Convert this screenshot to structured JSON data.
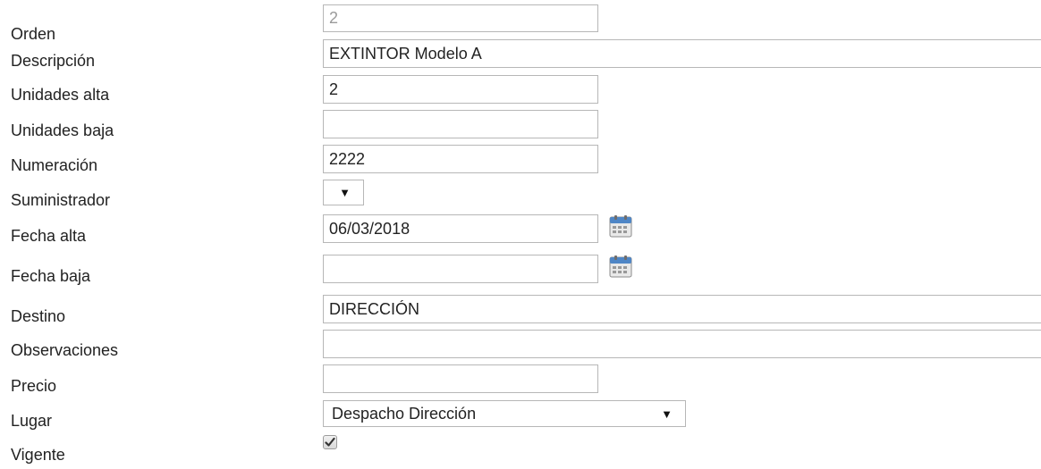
{
  "form": {
    "orden": {
      "label": "Orden",
      "value": "2"
    },
    "descripcion": {
      "label": "Descripción",
      "value": "EXTINTOR Modelo A"
    },
    "unidades_alta": {
      "label": "Unidades alta",
      "value": "2"
    },
    "unidades_baja": {
      "label": "Unidades baja",
      "value": ""
    },
    "numeracion": {
      "label": "Numeración",
      "value": "2222"
    },
    "suministrador": {
      "label": "Suministrador",
      "value": "",
      "arrow": "▼"
    },
    "fecha_alta": {
      "label": "Fecha alta",
      "value": "06/03/2018",
      "icon": "calendar-icon"
    },
    "fecha_baja": {
      "label": "Fecha baja",
      "value": "",
      "icon": "calendar-icon"
    },
    "destino": {
      "label": "Destino",
      "value": "DIRECCIÓN"
    },
    "observaciones": {
      "label": "Observaciones",
      "value": ""
    },
    "precio": {
      "label": "Precio",
      "value": ""
    },
    "lugar": {
      "label": "Lugar",
      "value": "Despacho Dirección",
      "arrow": "▼"
    },
    "vigente": {
      "label": "Vigente",
      "checked": true
    }
  },
  "colors": {
    "border": "#b7b7b7",
    "text": "#222222",
    "readonly_text": "#9a9a9a",
    "calendar_blue": "#4f86c6"
  }
}
